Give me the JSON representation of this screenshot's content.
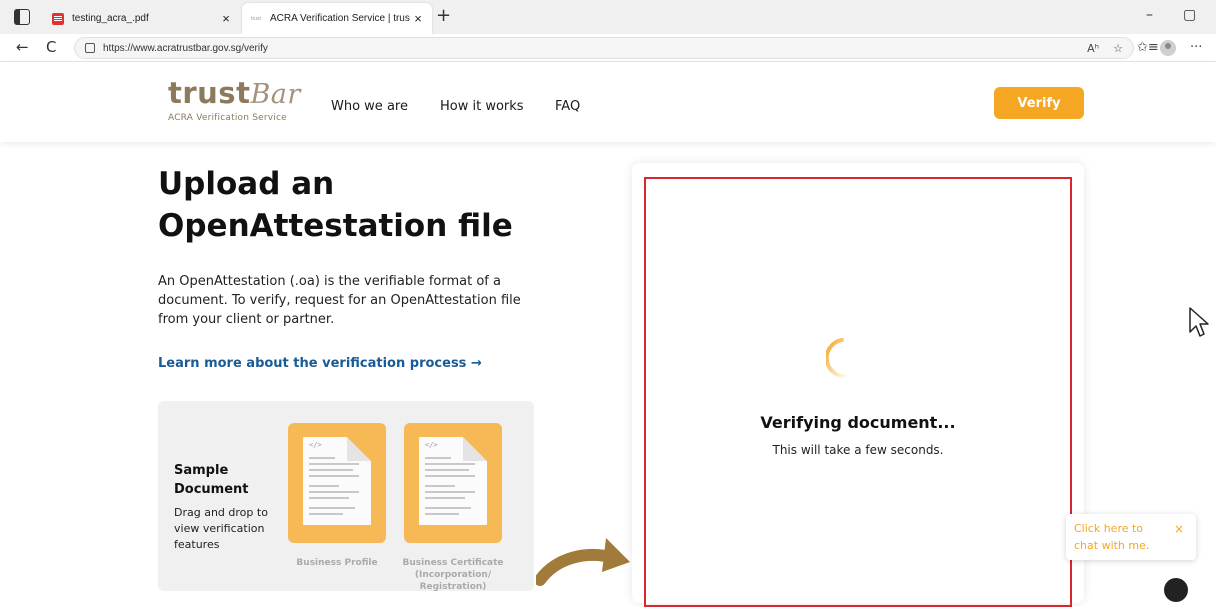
{
  "browser": {
    "tabs": [
      {
        "title": "testing_acra_.pdf",
        "close": "×"
      },
      {
        "title": "ACRA Verification Service | trustBar",
        "favicon_text": "trust",
        "close": "×"
      }
    ],
    "new_tab": "+",
    "window": {
      "minimize": "–",
      "restore": "▢"
    },
    "nav": {
      "back": "←",
      "refresh": "C"
    },
    "url": "https://www.acratrustbar.gov.sg/verify",
    "url_icons": {
      "read_aloud": "Aʰ",
      "favorite": "☆"
    },
    "toolbar": {
      "collections": "✩≡",
      "more": "···"
    }
  },
  "header": {
    "logo_word": "trust",
    "logo_script": "Bar",
    "logo_sub": "ACRA Verification Service",
    "nav": [
      "Who we are",
      "How it works",
      "FAQ"
    ],
    "verify_label": "Verify"
  },
  "hero": {
    "title": "Upload an OpenAttestation file",
    "description": "An OpenAttestation (.oa) is the verifiable format of a document. To verify, request for an OpenAttestation file from your client or partner.",
    "learn_more": "Learn more about the verification process  →"
  },
  "sample": {
    "title": "Sample Document",
    "description": "Drag and drop to view verification features",
    "docs": [
      {
        "label": "Business Profile",
        "code": "</>"
      },
      {
        "label": "Business Certificate (Incorporation/ Registration)",
        "code": "</>"
      }
    ]
  },
  "verification": {
    "status": "Verifying document...",
    "subtext": "This will take a few seconds."
  },
  "chat": {
    "text": "Click here to chat with me.",
    "close": "×"
  },
  "colors": {
    "accent": "#f5a623",
    "brand": "#8d7a5c",
    "link": "#1a5b96",
    "drop_border": "#d7262c"
  }
}
